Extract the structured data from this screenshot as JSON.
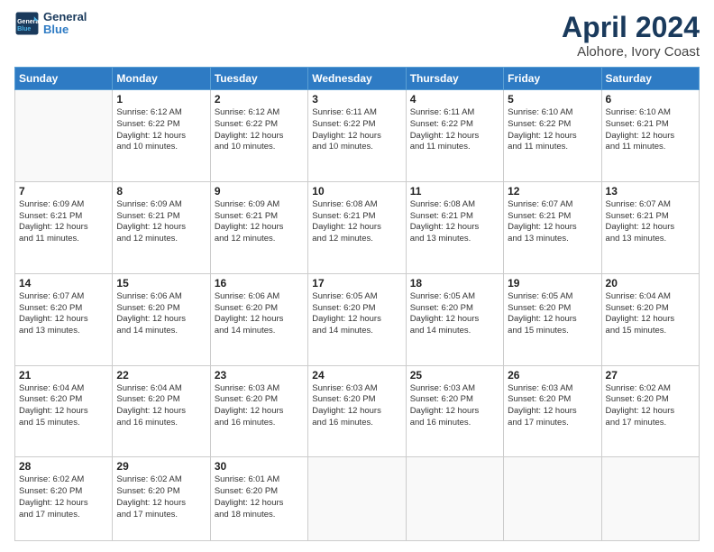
{
  "logo": {
    "line1": "General",
    "line2": "Blue"
  },
  "title": "April 2024",
  "subtitle": "Alohore, Ivory Coast",
  "days_header": [
    "Sunday",
    "Monday",
    "Tuesday",
    "Wednesday",
    "Thursday",
    "Friday",
    "Saturday"
  ],
  "weeks": [
    [
      {
        "day": "",
        "info": ""
      },
      {
        "day": "1",
        "info": "Sunrise: 6:12 AM\nSunset: 6:22 PM\nDaylight: 12 hours\nand 10 minutes."
      },
      {
        "day": "2",
        "info": "Sunrise: 6:12 AM\nSunset: 6:22 PM\nDaylight: 12 hours\nand 10 minutes."
      },
      {
        "day": "3",
        "info": "Sunrise: 6:11 AM\nSunset: 6:22 PM\nDaylight: 12 hours\nand 10 minutes."
      },
      {
        "day": "4",
        "info": "Sunrise: 6:11 AM\nSunset: 6:22 PM\nDaylight: 12 hours\nand 11 minutes."
      },
      {
        "day": "5",
        "info": "Sunrise: 6:10 AM\nSunset: 6:22 PM\nDaylight: 12 hours\nand 11 minutes."
      },
      {
        "day": "6",
        "info": "Sunrise: 6:10 AM\nSunset: 6:21 PM\nDaylight: 12 hours\nand 11 minutes."
      }
    ],
    [
      {
        "day": "7",
        "info": "Sunrise: 6:09 AM\nSunset: 6:21 PM\nDaylight: 12 hours\nand 11 minutes."
      },
      {
        "day": "8",
        "info": "Sunrise: 6:09 AM\nSunset: 6:21 PM\nDaylight: 12 hours\nand 12 minutes."
      },
      {
        "day": "9",
        "info": "Sunrise: 6:09 AM\nSunset: 6:21 PM\nDaylight: 12 hours\nand 12 minutes."
      },
      {
        "day": "10",
        "info": "Sunrise: 6:08 AM\nSunset: 6:21 PM\nDaylight: 12 hours\nand 12 minutes."
      },
      {
        "day": "11",
        "info": "Sunrise: 6:08 AM\nSunset: 6:21 PM\nDaylight: 12 hours\nand 13 minutes."
      },
      {
        "day": "12",
        "info": "Sunrise: 6:07 AM\nSunset: 6:21 PM\nDaylight: 12 hours\nand 13 minutes."
      },
      {
        "day": "13",
        "info": "Sunrise: 6:07 AM\nSunset: 6:21 PM\nDaylight: 12 hours\nand 13 minutes."
      }
    ],
    [
      {
        "day": "14",
        "info": "Sunrise: 6:07 AM\nSunset: 6:20 PM\nDaylight: 12 hours\nand 13 minutes."
      },
      {
        "day": "15",
        "info": "Sunrise: 6:06 AM\nSunset: 6:20 PM\nDaylight: 12 hours\nand 14 minutes."
      },
      {
        "day": "16",
        "info": "Sunrise: 6:06 AM\nSunset: 6:20 PM\nDaylight: 12 hours\nand 14 minutes."
      },
      {
        "day": "17",
        "info": "Sunrise: 6:05 AM\nSunset: 6:20 PM\nDaylight: 12 hours\nand 14 minutes."
      },
      {
        "day": "18",
        "info": "Sunrise: 6:05 AM\nSunset: 6:20 PM\nDaylight: 12 hours\nand 14 minutes."
      },
      {
        "day": "19",
        "info": "Sunrise: 6:05 AM\nSunset: 6:20 PM\nDaylight: 12 hours\nand 15 minutes."
      },
      {
        "day": "20",
        "info": "Sunrise: 6:04 AM\nSunset: 6:20 PM\nDaylight: 12 hours\nand 15 minutes."
      }
    ],
    [
      {
        "day": "21",
        "info": "Sunrise: 6:04 AM\nSunset: 6:20 PM\nDaylight: 12 hours\nand 15 minutes."
      },
      {
        "day": "22",
        "info": "Sunrise: 6:04 AM\nSunset: 6:20 PM\nDaylight: 12 hours\nand 16 minutes."
      },
      {
        "day": "23",
        "info": "Sunrise: 6:03 AM\nSunset: 6:20 PM\nDaylight: 12 hours\nand 16 minutes."
      },
      {
        "day": "24",
        "info": "Sunrise: 6:03 AM\nSunset: 6:20 PM\nDaylight: 12 hours\nand 16 minutes."
      },
      {
        "day": "25",
        "info": "Sunrise: 6:03 AM\nSunset: 6:20 PM\nDaylight: 12 hours\nand 16 minutes."
      },
      {
        "day": "26",
        "info": "Sunrise: 6:03 AM\nSunset: 6:20 PM\nDaylight: 12 hours\nand 17 minutes."
      },
      {
        "day": "27",
        "info": "Sunrise: 6:02 AM\nSunset: 6:20 PM\nDaylight: 12 hours\nand 17 minutes."
      }
    ],
    [
      {
        "day": "28",
        "info": "Sunrise: 6:02 AM\nSunset: 6:20 PM\nDaylight: 12 hours\nand 17 minutes."
      },
      {
        "day": "29",
        "info": "Sunrise: 6:02 AM\nSunset: 6:20 PM\nDaylight: 12 hours\nand 17 minutes."
      },
      {
        "day": "30",
        "info": "Sunrise: 6:01 AM\nSunset: 6:20 PM\nDaylight: 12 hours\nand 18 minutes."
      },
      {
        "day": "",
        "info": ""
      },
      {
        "day": "",
        "info": ""
      },
      {
        "day": "",
        "info": ""
      },
      {
        "day": "",
        "info": ""
      }
    ]
  ]
}
